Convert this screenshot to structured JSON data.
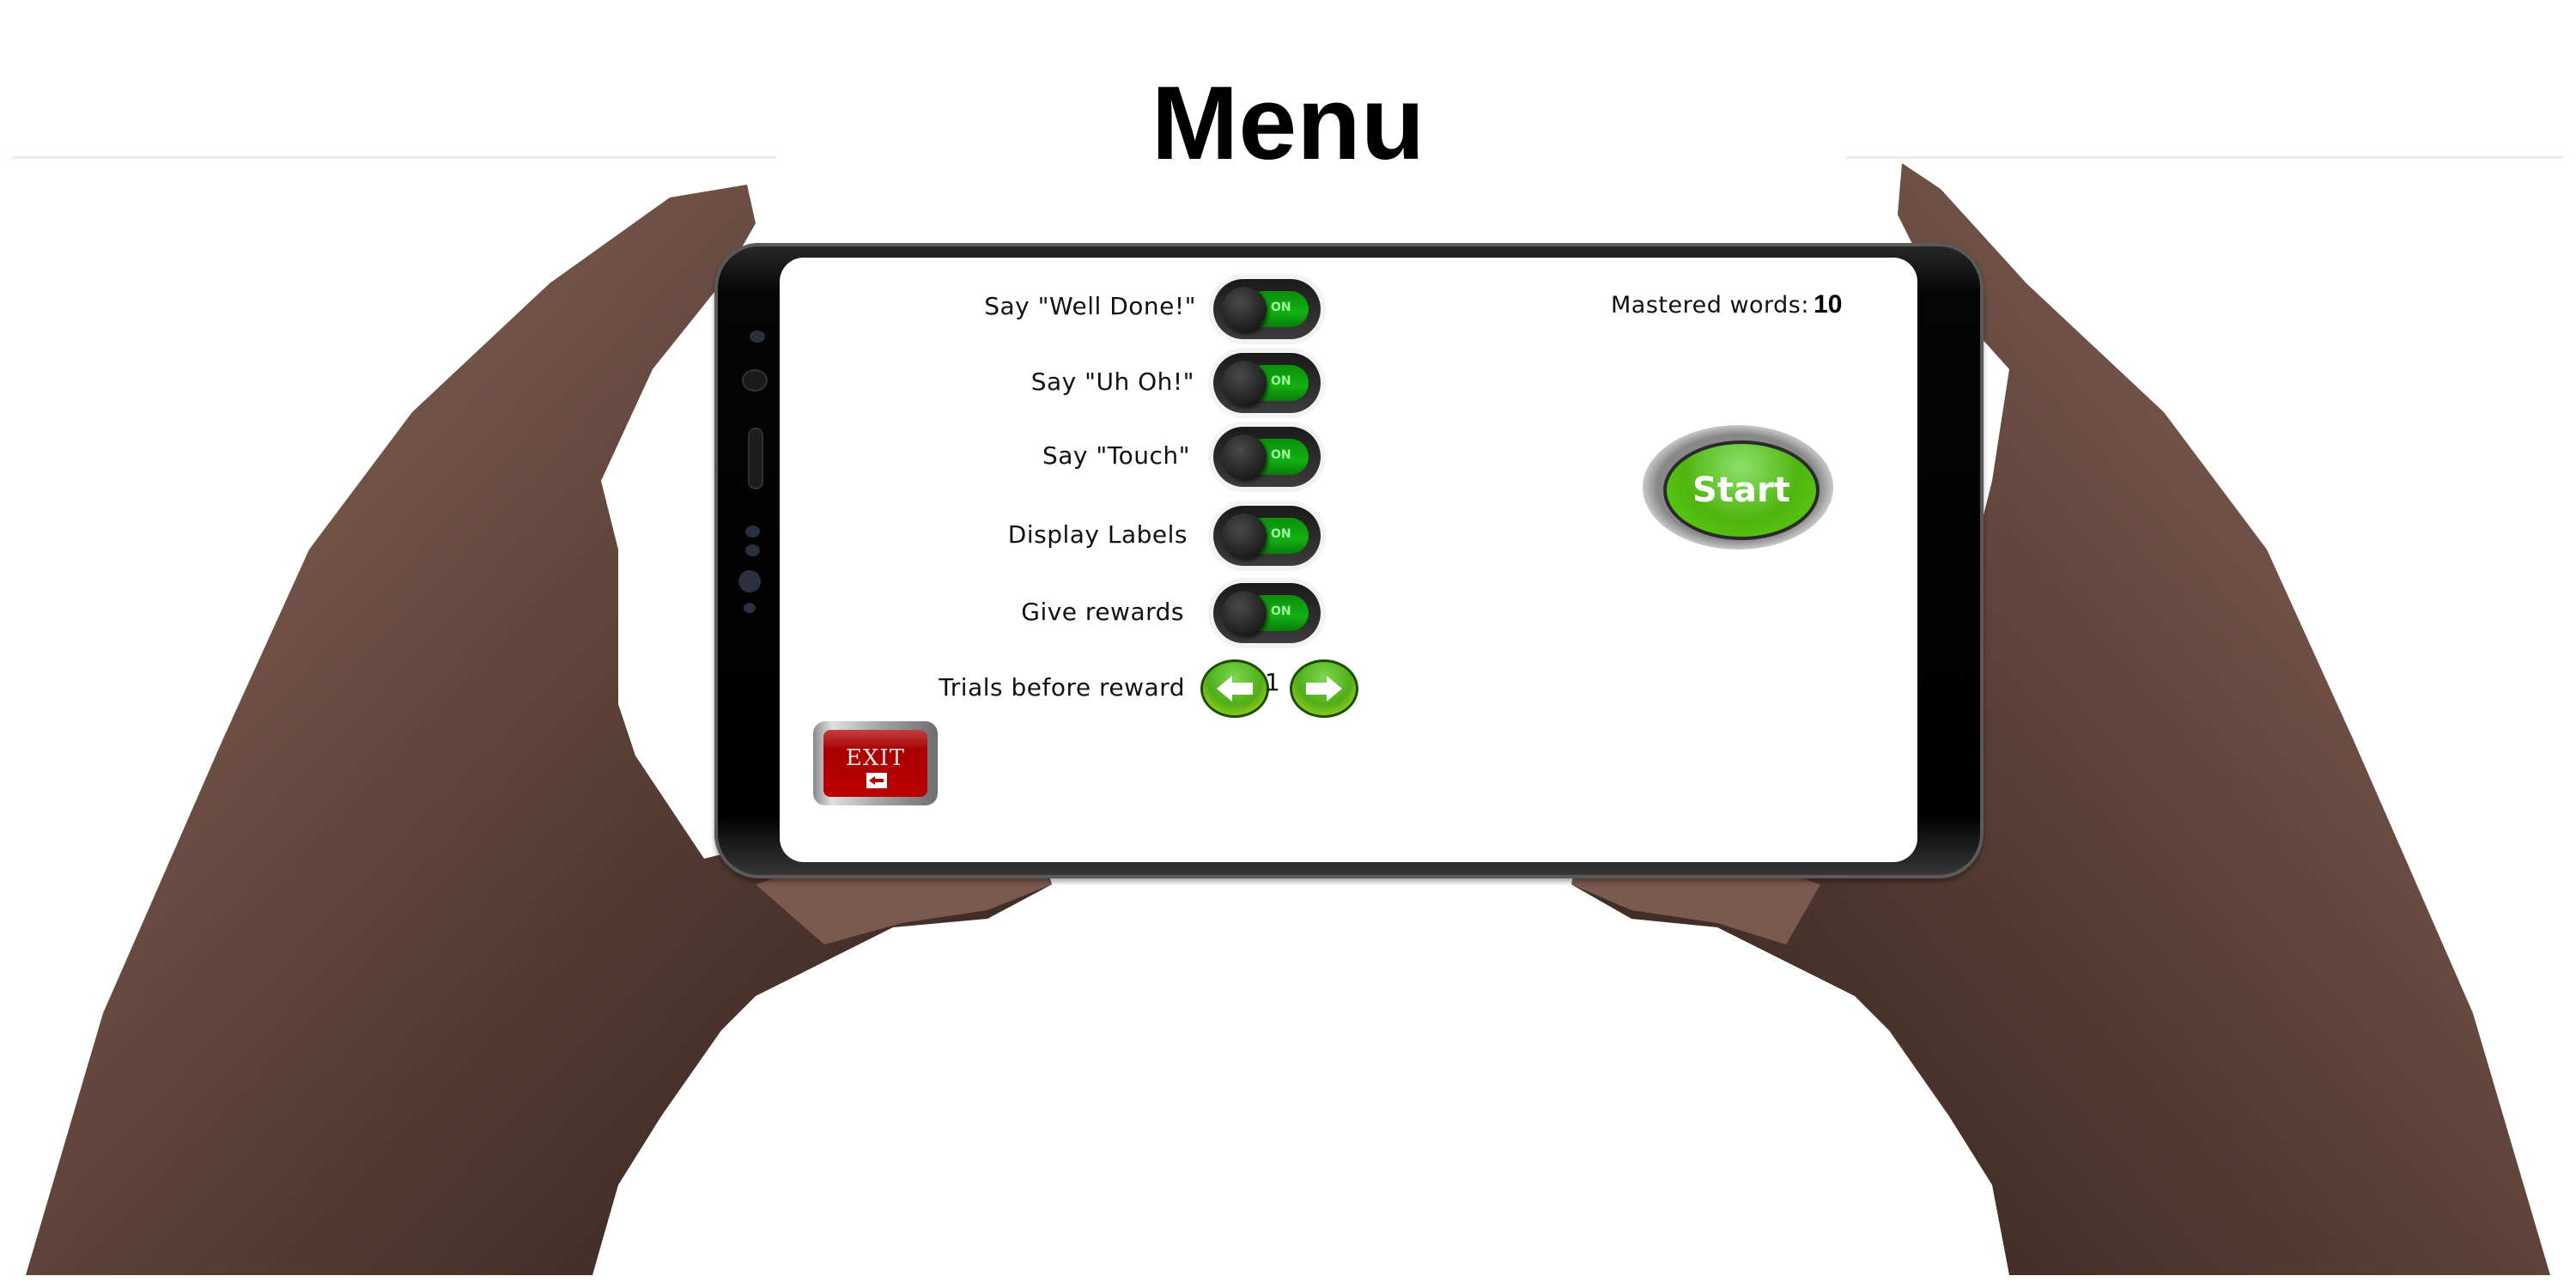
{
  "page": {
    "title": "Menu"
  },
  "settings": [
    {
      "label": "Say \"Well Done!\"",
      "toggle_state": "ON",
      "enabled": true
    },
    {
      "label": "Say \"Uh Oh!\"",
      "toggle_state": "ON",
      "enabled": true
    },
    {
      "label": "Say \"Touch\"",
      "toggle_state": "ON",
      "enabled": true
    },
    {
      "label": "Display Labels",
      "toggle_state": "ON",
      "enabled": true
    },
    {
      "label": "Give rewards",
      "toggle_state": "ON",
      "enabled": true
    }
  ],
  "trials": {
    "label": "Trials before reward",
    "value": "1",
    "decrement_icon": "arrow-left-icon",
    "increment_icon": "arrow-right-icon"
  },
  "stats": {
    "mastered_label": "Mastered words:",
    "mastered_value": "10"
  },
  "buttons": {
    "start_label": "Start",
    "exit_label": "EXIT",
    "exit_icon": "exit-door-icon"
  },
  "colors": {
    "toggle_on": "#12b012",
    "start_green": "#4eb50f",
    "exit_red": "#aa0000",
    "skin": "#5a3f36"
  }
}
